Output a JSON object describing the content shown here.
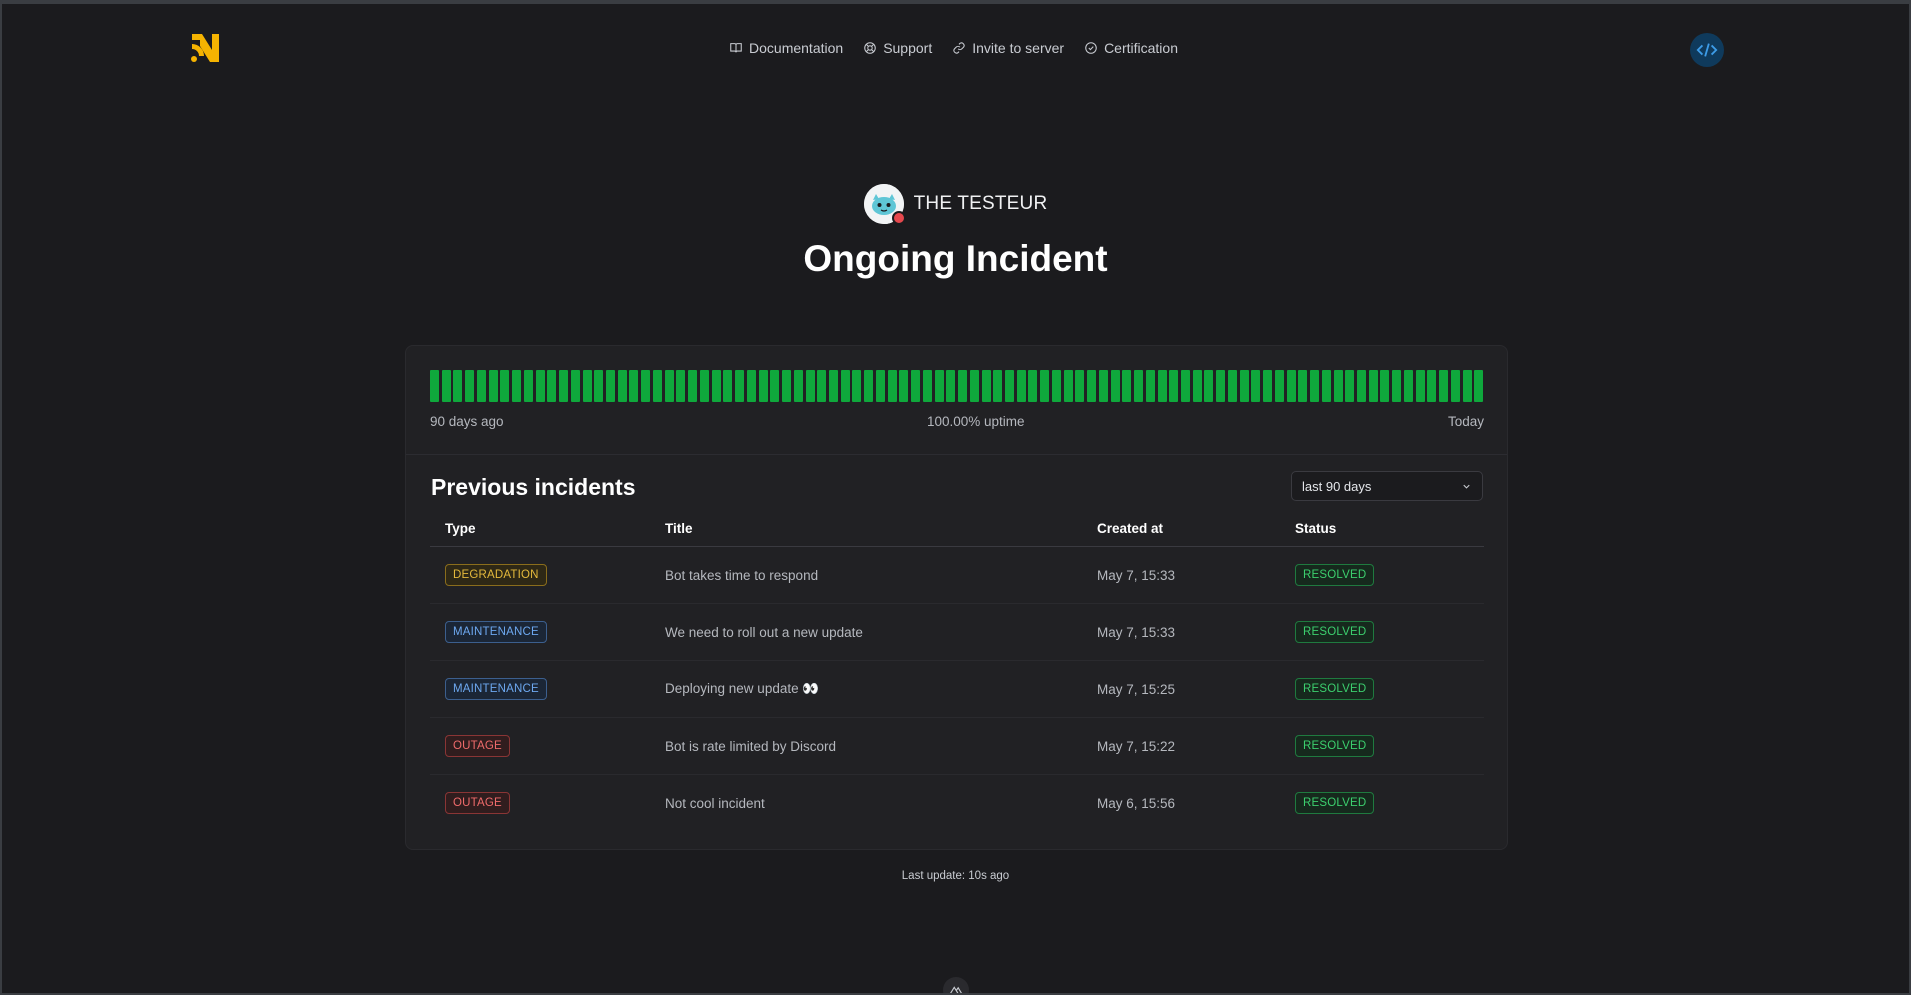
{
  "nav": {
    "items": [
      {
        "label": "Documentation",
        "icon": "book-icon"
      },
      {
        "label": "Support",
        "icon": "lifebuoy-icon"
      },
      {
        "label": "Invite to server",
        "icon": "link-icon"
      },
      {
        "label": "Certification",
        "icon": "check-circle-icon"
      }
    ]
  },
  "header": {
    "server_name": "THE TESTEUR",
    "title": "Ongoing Incident"
  },
  "uptime": {
    "bar_count": 90,
    "bar_color": "#0fa83c",
    "start_label": "90 days ago",
    "uptime_label": "100.00% uptime",
    "end_label": "Today"
  },
  "incidents": {
    "section_title": "Previous incidents",
    "range_select": "last 90 days",
    "headers": {
      "type": "Type",
      "title": "Title",
      "created_at": "Created at",
      "status": "Status"
    },
    "rows": [
      {
        "type": "DEGRADATION",
        "title": "Bot takes time to respond",
        "created_at": "May 7, 15:33",
        "status": "RESOLVED"
      },
      {
        "type": "MAINTENANCE",
        "title": "We need to roll out a new update",
        "created_at": "May 7, 15:33",
        "status": "RESOLVED"
      },
      {
        "type": "MAINTENANCE",
        "title": "Deploying new update 👀",
        "created_at": "May 7, 15:25",
        "status": "RESOLVED"
      },
      {
        "type": "OUTAGE",
        "title": "Bot is rate limited by Discord",
        "created_at": "May 7, 15:22",
        "status": "RESOLVED"
      },
      {
        "type": "OUTAGE",
        "title": "Not cool incident",
        "created_at": "May 6, 15:56",
        "status": "RESOLVED"
      }
    ]
  },
  "footer": {
    "last_update": "Last update: 10s ago"
  },
  "colors": {
    "brand": "#f5b301",
    "degradation": "#e4b93c",
    "maintenance": "#6da8f0",
    "outage": "#ef6b6b",
    "resolved": "#3ccf6e"
  }
}
